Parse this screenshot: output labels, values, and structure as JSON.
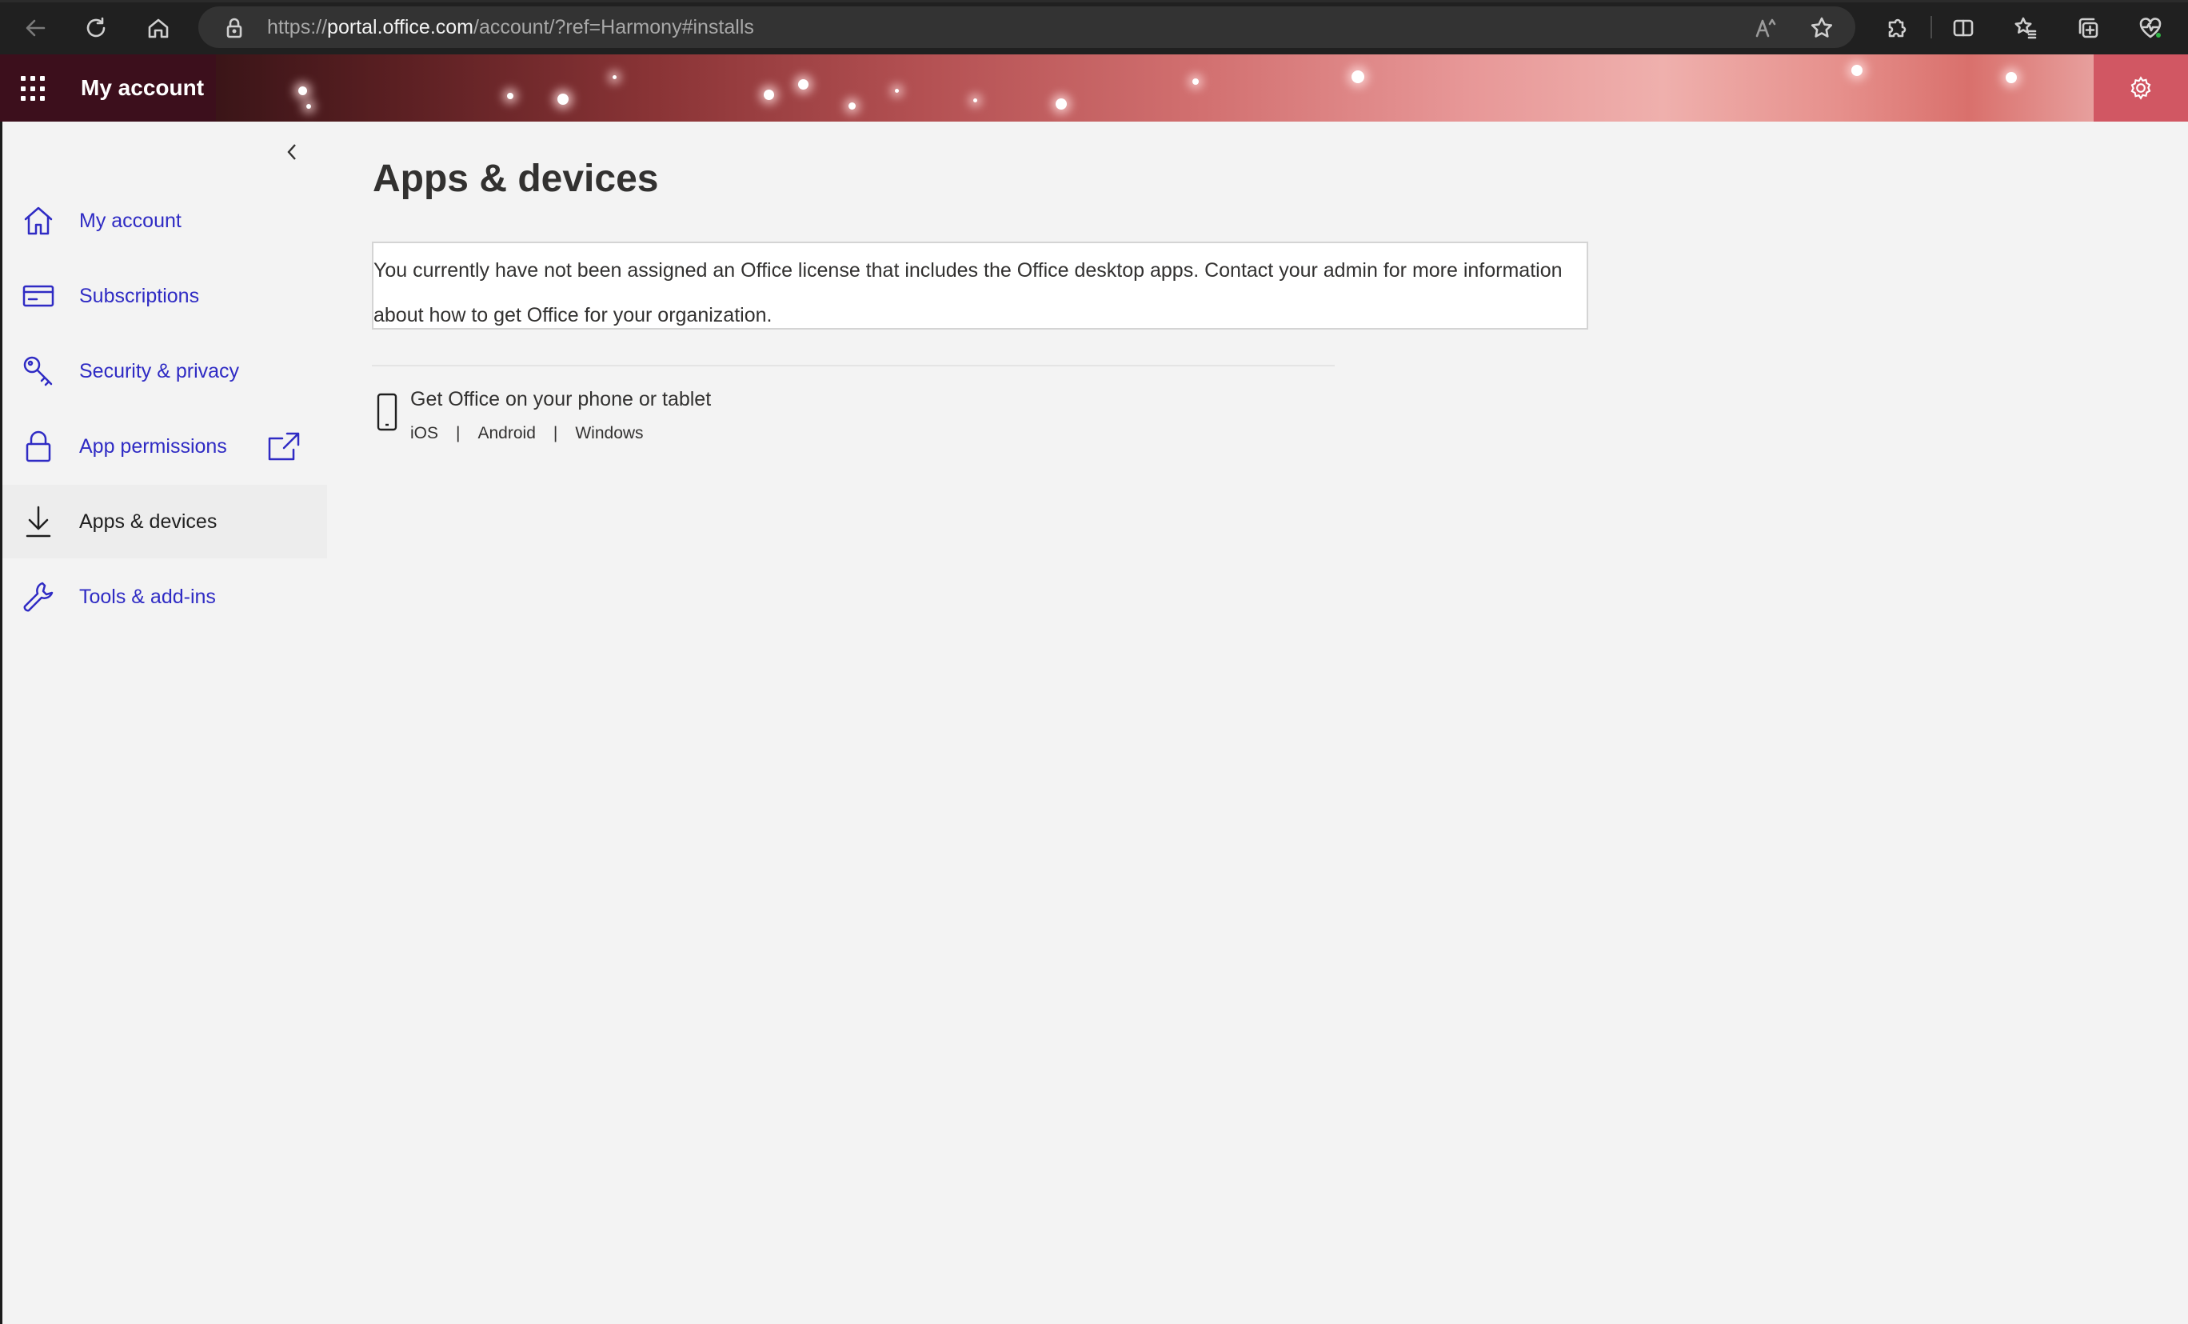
{
  "browser": {
    "url_prefix": "https://",
    "url_host": "portal.office.com",
    "url_path": "/account/?ref=Harmony#installs",
    "icons": [
      "back-icon",
      "refresh-icon",
      "home-icon",
      "lock-icon",
      "read-aloud-icon",
      "favorite-star-icon",
      "extensions-icon",
      "split-screen-icon",
      "favorites-icon",
      "collections-icon",
      "browser-essentials-icon"
    ]
  },
  "header": {
    "app_title": "My account",
    "settings_icon": "gear-icon",
    "colors": {
      "left_block": "#3c0f1c",
      "settings_block": "#d15763"
    }
  },
  "sidebar": {
    "items": [
      {
        "label": "My account",
        "icon": "home-icon",
        "active": false
      },
      {
        "label": "Subscriptions",
        "icon": "card-icon",
        "active": false
      },
      {
        "label": "Security & privacy",
        "icon": "key-icon",
        "active": false
      },
      {
        "label": "App permissions",
        "icon": "lock-icon",
        "active": false,
        "external": true
      },
      {
        "label": "Apps & devices",
        "icon": "download-icon",
        "active": true
      },
      {
        "label": "Tools & add-ins",
        "icon": "wrench-icon",
        "active": false
      }
    ],
    "colors": {
      "link": "#2f2bc4",
      "active_text": "#1f1f1f"
    }
  },
  "main": {
    "title": "Apps & devices",
    "notice": "You currently have not been assigned an Office license that includes the Office desktop apps. Contact your admin for more information about how to get Office for your organization.",
    "mobile": {
      "heading": "Get Office on your phone or tablet",
      "links": [
        "iOS",
        "Android",
        "Windows"
      ]
    }
  }
}
